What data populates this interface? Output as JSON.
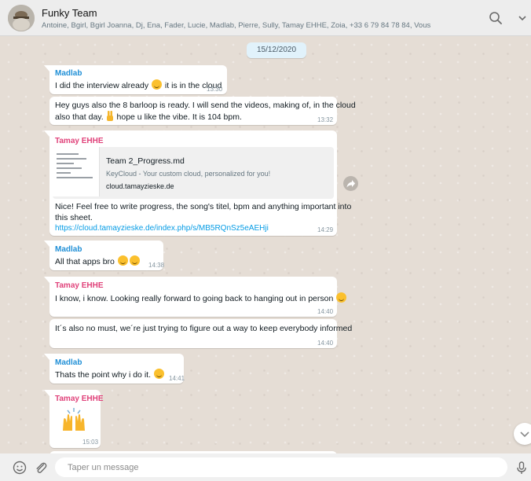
{
  "header": {
    "title": "Funky Team",
    "members": "Antoine, Bgirl, Bgirl Joanna, Dj, Ena, Fader, Lucie, Madlab, Pierre, Sully, Tamay EHHE, Zoia, +33 6 79 84 78 84, Vous",
    "icons": [
      "search-icon",
      "chevron-down-icon"
    ]
  },
  "chat": {
    "date": "15/12/2020",
    "messages": [
      {
        "sender": "Madlab",
        "sender_color": "#1f8fd6",
        "text": "I did the interview already",
        "text_after": "it is in the cloud",
        "emoji": "grinning-face",
        "time": "13:30"
      },
      {
        "text_line1": "Hey guys also the 8 barloop is ready. I will send the videos, making of, in the cloud",
        "text_line2": "also that day.",
        "text_line2b": "hope u like the vibe.  It is 104 bpm.",
        "emoji": "victory-hand",
        "time": "13:32"
      },
      {
        "sender": "Tamay EHHE",
        "sender_color": "#e0427a",
        "link_preview": {
          "title": "Team 2_Progress.md",
          "description": "KeyCloud - Your custom cloud, personalized for you!",
          "domain": "cloud.tamayzieske.de"
        },
        "text_line1": "Nice! Feel free to write progress, the song's titel, bpm and anything important into",
        "text_line2": "this sheet.",
        "link": "https://cloud.tamayzieske.de/index.php/s/MB5RQnSz5eAEHji",
        "time": "14:29"
      },
      {
        "sender": "Madlab",
        "sender_color": "#1f8fd6",
        "text": "All that apps bro",
        "emoji": "squinting-face-tongue",
        "time": "14:38"
      },
      {
        "sender": "Tamay EHHE",
        "sender_color": "#e0427a",
        "text": "I know, i know. Looking really forward to going back to hanging out in person",
        "emoji": "grinning-sweat",
        "time": "14:40"
      },
      {
        "text": "It´s also no must, we´re just trying to figure out a way to keep everybody informed",
        "time": "14:40"
      },
      {
        "sender": "Madlab",
        "sender_color": "#1f8fd6",
        "text": "Thats the point why i do it.",
        "emoji": "face-blowing-kiss",
        "time": "14:41"
      },
      {
        "sender": "Tamay EHHE",
        "sender_color": "#e0427a",
        "sticker": "raising-hands",
        "time": "15:03"
      }
    ]
  },
  "composer": {
    "placeholder": "Taper un message",
    "icons": [
      "emoji-icon",
      "attach-icon",
      "mic-icon"
    ]
  }
}
